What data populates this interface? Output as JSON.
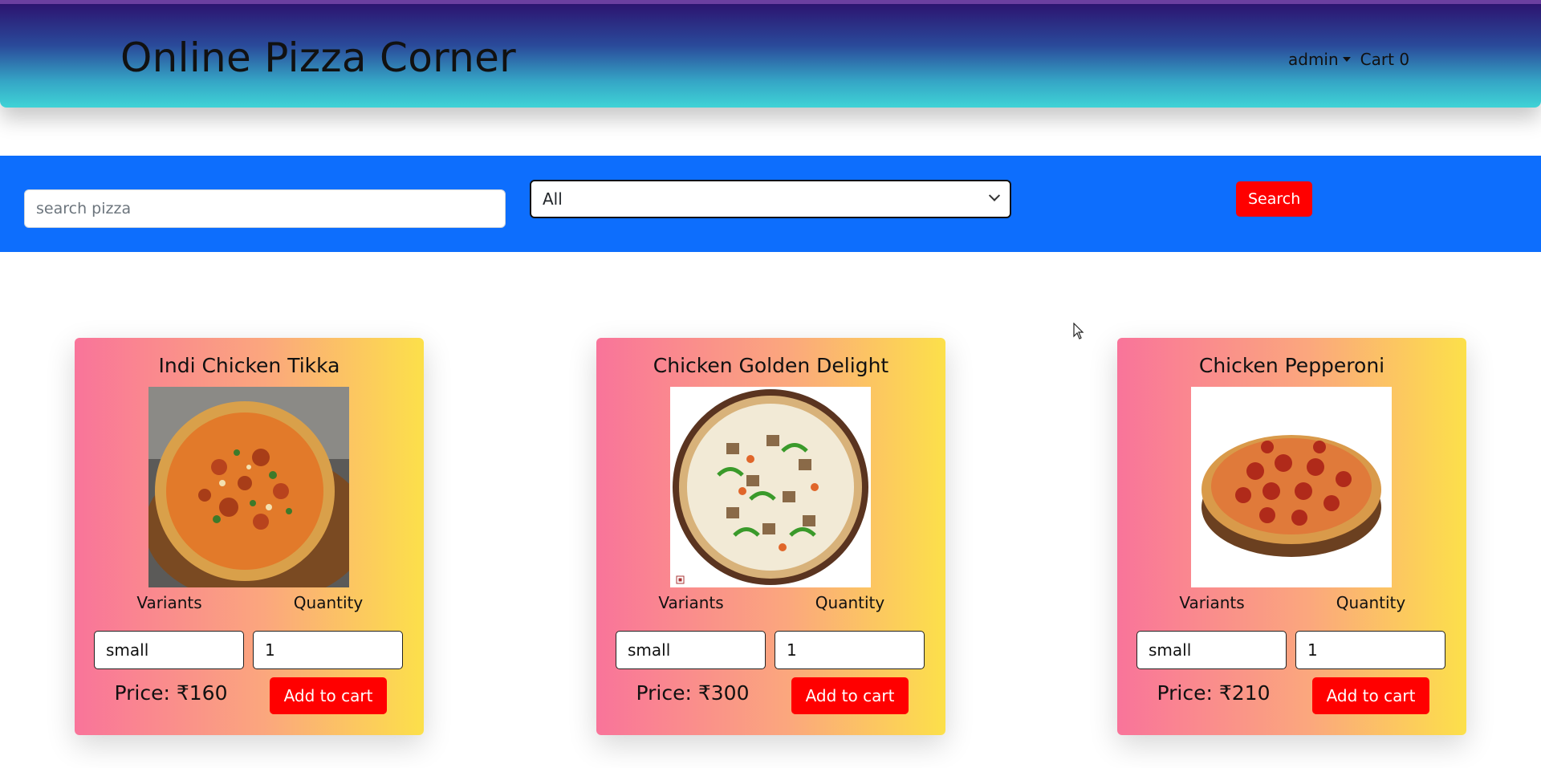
{
  "header": {
    "brand": "Online Pizza Corner",
    "user_menu_label": "admin",
    "cart_label": "Cart 0"
  },
  "filters": {
    "search_placeholder": "search pizza",
    "search_value": "",
    "category_selected": "All",
    "search_button": "Search"
  },
  "pizzas": [
    {
      "name": "Indi Chicken Tikka",
      "variants_label": "Variants",
      "quantity_label": "Quantity",
      "variant": "small",
      "quantity": "1",
      "price": "Price: ₹160",
      "add_button": "Add to cart"
    },
    {
      "name": "Chicken Golden Delight",
      "variants_label": "Variants",
      "quantity_label": "Quantity",
      "variant": "small",
      "quantity": "1",
      "price": "Price: ₹300",
      "add_button": "Add to cart"
    },
    {
      "name": "Chicken Pepperoni",
      "variants_label": "Variants",
      "quantity_label": "Quantity",
      "variant": "small",
      "quantity": "1",
      "price": "Price: ₹210",
      "add_button": "Add to cart"
    }
  ],
  "colors": {
    "filter_bar": "#0d6efd",
    "button_red": "#ff0000",
    "card_gradient_start": "#f9749a",
    "card_gradient_end": "#fce04a"
  }
}
